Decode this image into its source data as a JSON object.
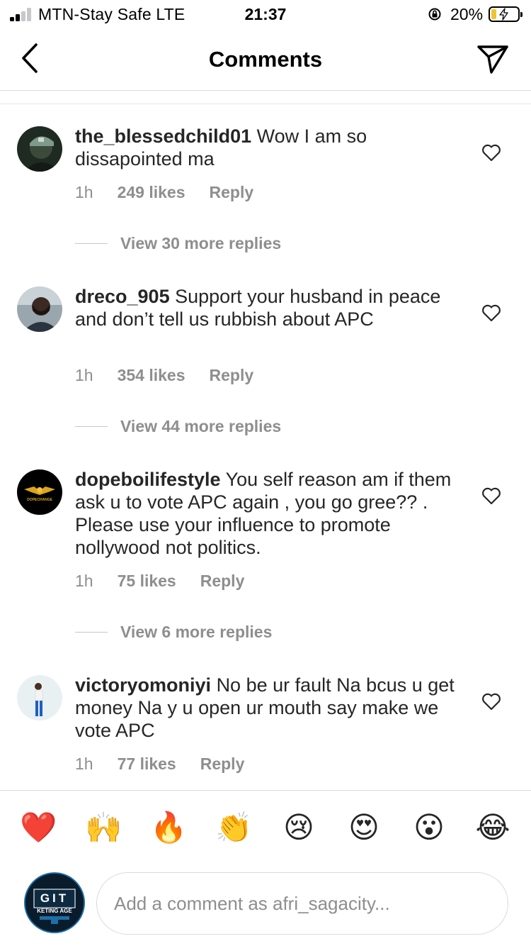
{
  "status_bar": {
    "carrier": "MTN-Stay Safe  LTE",
    "time": "21:37",
    "battery_percent": "20%",
    "battery_level": 0.2,
    "signal_bars": 2
  },
  "header": {
    "title": "Comments",
    "back_icon": "chevron-left-icon",
    "share_icon": "paper-plane-icon"
  },
  "comments": [
    {
      "username": "the_blessedchild01",
      "text": "Wow I am so dissapointed ma",
      "time": "1h",
      "likes": "249 likes",
      "reply": "Reply",
      "view_replies": "View 30 more replies"
    },
    {
      "username": "dreco_905",
      "text": "Support your husband in peace and don’t tell us rubbish about APC",
      "time": "1h",
      "likes": "354 likes",
      "reply": "Reply",
      "view_replies": "View 44 more replies"
    },
    {
      "username": "dopeboilifestyle",
      "text": "You self reason am if them ask u to vote APC again , you go gree?? . Please use your influence to promote nollywood not politics.",
      "time": "1h",
      "likes": "75 likes",
      "reply": "Reply",
      "view_replies": "View 6 more replies"
    },
    {
      "username": "victoryomoniyi",
      "text": "No be ur fault Na bcus u get money Na y u open ur mouth say make we vote APC",
      "time": "1h",
      "likes": "77 likes",
      "reply": "Reply"
    }
  ],
  "avatar_logo_text": "DOPECHANGE",
  "emoji_bar": [
    "❤️",
    "🙌",
    "🔥",
    "👏",
    "😢",
    "😍",
    "😮",
    "😂"
  ],
  "composer": {
    "placeholder": "Add a comment as afri_sagacity...",
    "value": "",
    "avatar_text_top": "GIT",
    "avatar_text_bottom": "KETING AGE"
  },
  "colors": {
    "text": "#262626",
    "muted": "#8e8e8e",
    "divider": "#dbdbdb",
    "battery_fill": "#f2c230"
  }
}
